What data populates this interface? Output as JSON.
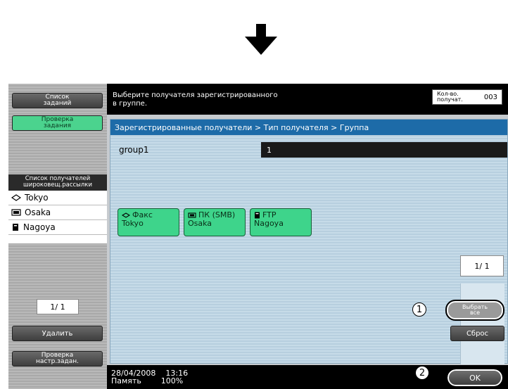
{
  "left": {
    "job_list_btn": "Список\nзаданий",
    "check_job_btn": "Проверка\nзадания",
    "list_header": "Список получателей\nшироковещ.рассылки",
    "items": [
      {
        "icon": "fax-icon",
        "label": "Tokyo"
      },
      {
        "icon": "pc-icon",
        "label": "Osaka"
      },
      {
        "icon": "ftp-icon",
        "label": "Nagoya"
      }
    ],
    "page": "1/ 1",
    "delete_btn": "Удалить",
    "check_settings_btn": "Проверка\nнастр.задан."
  },
  "header": {
    "instruction": "Выберите получателя зарегистрированного\nв группе.",
    "count_label": "Кол-во.\nполучат.",
    "count_value": "003"
  },
  "breadcrumb": "Зарегистрированные получатели > Тип получателя > Группа",
  "group": {
    "name": "group1",
    "value": "1"
  },
  "destinations": [
    {
      "type": "Факс",
      "name": "Tokyo",
      "icon": "fax-icon"
    },
    {
      "type": "ПК (SMB)",
      "name": "Osaka",
      "icon": "pc-icon"
    },
    {
      "type": "FTP",
      "name": "Nagoya",
      "icon": "ftp-icon"
    }
  ],
  "pager": "1/ 1",
  "select_all_btn": "Выбрать\nвсе",
  "reset_btn": "Сброс",
  "ok_btn": "OK",
  "status": {
    "datetime": "28/04/2008    13:16",
    "memory": "Память        100%"
  },
  "callouts": [
    "1",
    "2"
  ]
}
